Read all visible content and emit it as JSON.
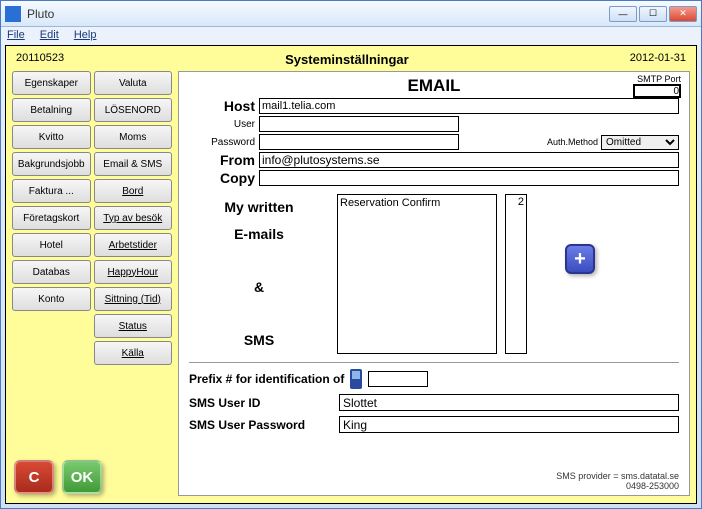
{
  "window": {
    "title": "Pluto"
  },
  "menu": {
    "file": "File",
    "edit": "Edit",
    "help": "Help"
  },
  "header": {
    "left_code": "20110523",
    "title": "Systeminställningar",
    "date": "2012-01-31"
  },
  "sidebar": {
    "buttons": [
      [
        "Egenskaper",
        "Valuta"
      ],
      [
        "Betalning",
        "LÖSENORD"
      ],
      [
        "Kvitto",
        "Moms"
      ],
      [
        "Bakgrundsjobb",
        "Email & SMS"
      ],
      [
        "Faktura ...",
        "Bord"
      ],
      [
        "Företagskort",
        "Typ av besök"
      ],
      [
        "Hotel",
        "Arbetstider"
      ],
      [
        "Databas",
        "HappyHour"
      ],
      [
        "Konto",
        "Sittning (Tid)"
      ]
    ],
    "extra": [
      "Status",
      "Källa"
    ]
  },
  "actions": {
    "cancel": "C",
    "ok": "OK"
  },
  "email": {
    "section_title": "EMAIL",
    "smtp_label": "SMTP Port",
    "smtp_port": "0",
    "host_label": "Host",
    "host": "mail1.telia.com",
    "user_label": "User",
    "user": "",
    "password_label": "Password",
    "password": "",
    "auth_label": "Auth.Method",
    "auth_value": "Omitted",
    "from_label": "From",
    "from": "info@plutosystems.se",
    "copy_label": "Copy",
    "copy": "",
    "my_written_label": "My written",
    "emails_label": "E-mails",
    "and_label": "&",
    "sms_label": "SMS",
    "list_item": "Reservation Confirm",
    "list_count": "2",
    "add": "+"
  },
  "sms": {
    "prefix_label": "Prefix # for identification of",
    "prefix": "",
    "user_id_label": "SMS User ID",
    "user_id": "Slottet",
    "password_label": "SMS User Password",
    "password": "King"
  },
  "footer": {
    "line1": "SMS provider = sms.datatal.se",
    "line2": "0498-253000"
  }
}
